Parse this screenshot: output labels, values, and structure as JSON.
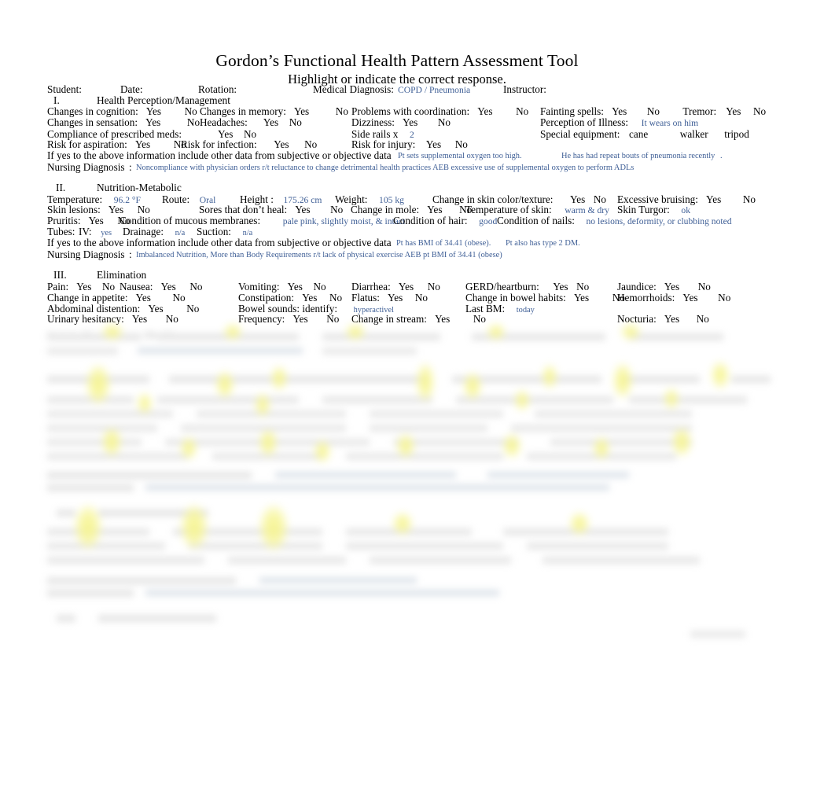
{
  "document": {
    "title": "Gordon’s Functional Health Pattern Assessment Tool",
    "subtitle": "Highlight or indicate the correct response."
  },
  "header_fields": {
    "student_label": "Student:",
    "student_value": "",
    "date_label": "Date:",
    "date_value": "",
    "rotation_label": "Rotation:",
    "rotation_value": "",
    "medical_diagnosis_label": "Medical Diagnosis:",
    "medical_diagnosis_value": "COPD / Pneumonia",
    "instructor_label": "Instructor:",
    "instructor_value": ""
  },
  "sections": [
    {
      "number": "I.",
      "name": "Health Perception/Management",
      "rows": [
        {
          "items": [
            {
              "label": "Changes in cognition:",
              "yes": "Yes",
              "no": "No",
              "highlight": "no"
            },
            {
              "label": "Changes in memory:",
              "yes": "Yes",
              "no": "No",
              "highlight": "no"
            },
            {
              "label": "Problems with coordination:",
              "yes": "Yes",
              "no": "No",
              "highlight": "no"
            },
            {
              "label": "Fainting spells:",
              "yes": "Yes",
              "no": "No",
              "highlight": "no"
            },
            {
              "label": "Tremor:",
              "yes": "Yes",
              "no": "No",
              "highlight": "no"
            }
          ]
        },
        {
          "items": [
            {
              "label": "Changes in sensation:",
              "yes": "Yes",
              "no": "No",
              "highlight": "no"
            },
            {
              "label": "Headaches:",
              "yes": "Yes",
              "no": "No",
              "highlight": "no"
            },
            {
              "label": "Dizziness:",
              "yes": "Yes",
              "no": "No",
              "highlight": "no"
            },
            {
              "label": "Perception of Illness:",
              "value": "It wears on him"
            }
          ]
        },
        {
          "items": [
            {
              "label": "Compliance of prescribed meds:",
              "yes": "Yes",
              "no": "No",
              "highlight": "no"
            },
            {
              "label": "Side rails x",
              "value": "2"
            },
            {
              "label": "Special equipment:",
              "options": [
                "cane",
                "walker",
                "tripod"
              ]
            }
          ]
        },
        {
          "items": [
            {
              "label": "Risk for aspiration:",
              "yes": "Yes",
              "no": "No",
              "highlight": "no"
            },
            {
              "label": "Risk for infection:",
              "yes": "Yes",
              "no": "No",
              "highlight": "yes"
            },
            {
              "label": "Risk for injury:",
              "yes": "Yes",
              "no": "No",
              "highlight": "yes"
            }
          ]
        }
      ],
      "other_data_label": "If yes to the above information include other data from subjective or objective data",
      "other_data_values": [
        "Pt sets supplemental oxygen too high.",
        "He has had repeat bouts of pneumonia recently",
        "."
      ],
      "nursing_diagnosis_label": "Nursing Diagnosis",
      "nursing_diagnosis_colon": ":",
      "nursing_diagnosis_value": "Noncompliance with physician orders r/t reluctance to change detrimental health practices AEB excessive use of supplemental oxygen to perform ADLs"
    },
    {
      "number": "II.",
      "name": "Nutrition-Metabolic",
      "rows": [
        {
          "items": [
            {
              "label": "Temperature:",
              "value": "96.2 °F"
            },
            {
              "label": "Route:",
              "value": "Oral"
            },
            {
              "label": "Height :",
              "value": "175.26 cm"
            },
            {
              "label": "Weight:",
              "value": "105 kg"
            },
            {
              "label": "Change in skin color/texture:",
              "yes": "Yes",
              "no": "No",
              "highlight": "yes"
            },
            {
              "label": "Excessive bruising:",
              "yes": "Yes",
              "no": "No",
              "highlight": "no"
            }
          ]
        },
        {
          "items": [
            {
              "label": "Skin lesions:",
              "yes": "Yes",
              "no": "No",
              "highlight": "no"
            },
            {
              "label": "Sores that don’t heal:",
              "yes": "Yes",
              "no": "No",
              "highlight": "no"
            },
            {
              "label": "Change in mole:",
              "yes": "Yes",
              "no": "No",
              "highlight": "no"
            },
            {
              "label": "Temperature of skin:",
              "value": "warm & dry"
            },
            {
              "label": "Skin Turgor:",
              "value": "ok"
            }
          ]
        },
        {
          "items": [
            {
              "label": "Pruritis:",
              "yes": "Yes",
              "no": "No",
              "highlight": "no"
            },
            {
              "label": "Condition of mucous membranes:",
              "value": "pale pink, slightly moist, & intact"
            },
            {
              "label": "Condition of hair:",
              "value": "good"
            },
            {
              "label": "Condition of nails:",
              "value": "no lesions, deformity, or clubbing noted"
            }
          ]
        },
        {
          "items": [
            {
              "label": "Tubes:",
              "value": ""
            },
            {
              "label": "IV:",
              "value": "yes"
            },
            {
              "label": "Drainage:",
              "value": "n/a"
            },
            {
              "label": "Suction:",
              "value": "n/a"
            }
          ]
        }
      ],
      "other_data_label": "If yes to the above information include other data from subjective or objective data",
      "other_data_values": [
        "Pt has BMI of 34.41 (obese).",
        "Pt also has type 2 DM."
      ],
      "nursing_diagnosis_label": "Nursing Diagnosis",
      "nursing_diagnosis_colon": ":",
      "nursing_diagnosis_value": "Imbalanced Nutrition, More than Body Requirements r/t lack of physical exercise AEB pt BMI of 34.41 (obese)"
    },
    {
      "number": "III.",
      "name": "Elimination",
      "rows": [
        {
          "items": [
            {
              "label": "Pain:",
              "yes": "Yes",
              "no": "No",
              "highlight": "no"
            },
            {
              "label": "Nausea:",
              "yes": "Yes",
              "no": "No",
              "highlight": "no"
            },
            {
              "label": "Vomiting:",
              "yes": "Yes",
              "no": "No",
              "highlight": "no"
            },
            {
              "label": "Diarrhea:",
              "yes": "Yes",
              "no": "No",
              "highlight": "no"
            },
            {
              "label": "GERD/heartburn:",
              "yes": "Yes",
              "no": "No",
              "highlight": "yes"
            },
            {
              "label": "Jaundice:",
              "yes": "Yes",
              "no": "No",
              "highlight": "no"
            }
          ]
        },
        {
          "items": [
            {
              "label": "Change in appetite:",
              "yes": "Yes",
              "no": "No",
              "highlight": "no"
            },
            {
              "label": "Constipation:",
              "yes": "Yes",
              "no": "No",
              "highlight": "no"
            },
            {
              "label": "Flatus:",
              "yes": "Yes",
              "no": "No",
              "highlight": "no"
            },
            {
              "label": "Change in bowel habits:",
              "yes": "Yes",
              "no": "No",
              "highlight": "no"
            },
            {
              "label": "Hemorrhoids:",
              "yes": "Yes",
              "no": "No",
              "highlight": "no"
            }
          ]
        },
        {
          "items": [
            {
              "label": "Abdominal distention:",
              "yes": "Yes",
              "no": "No",
              "highlight": "no"
            },
            {
              "label": "Bowel sounds: identify:",
              "value": "hyperactivel"
            },
            {
              "label": "Last BM:",
              "value": "today"
            }
          ]
        },
        {
          "items": [
            {
              "label": "Urinary hesitancy:",
              "yes": "Yes",
              "no": "No",
              "highlight": "no"
            },
            {
              "label": "Frequency:",
              "yes": "Yes",
              "no": "No",
              "highlight": "no"
            },
            {
              "label": "Change in stream:",
              "yes": "Yes",
              "no": "No",
              "highlight": "no"
            },
            {
              "label": "Nocturia:",
              "yes": "Yes",
              "no": "No",
              "highlight": "no"
            }
          ]
        }
      ]
    }
  ],
  "obscured_region": {
    "note": "Lower portion of the page is blurred and illegible",
    "legible": false
  },
  "colors": {
    "ink_blue": "#3f5f96",
    "highlighter_yellow": "#f3f03c",
    "text_black": "#000000",
    "page_background": "#ffffff"
  }
}
